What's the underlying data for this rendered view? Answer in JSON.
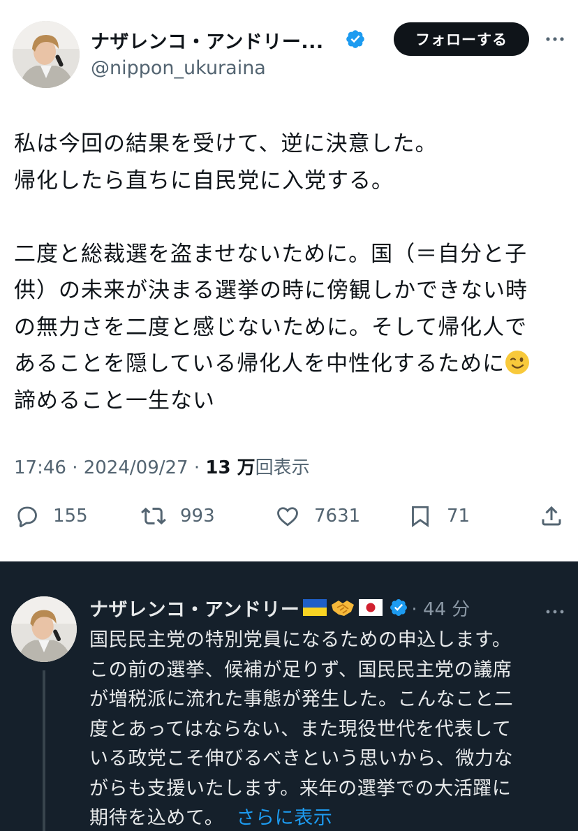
{
  "tweet": {
    "author_name": "ナザレンコ・アンドリー...",
    "handle": "@nippon_ukuraina",
    "follow_label": "フォローする",
    "body_lines": [
      "私は今回の結果を受けて、逆に決意した。",
      "帰化したら直ちに自民党に入党する。",
      "",
      "二度と総裁選を盗ませないために。国（＝自分と子",
      "供）の未来が決まる選挙の時に傍観しかできない時",
      "の無力さを二度と感じないために。そして帰化人で",
      "あることを隠している帰化人を中性化するために",
      "諦めること一生ない"
    ],
    "timestamp": "17:46 · 2024/09/27 · ",
    "views_count": "13 万",
    "views_label": "回表示",
    "stats": {
      "replies": "155",
      "retweets": "993",
      "likes": "7631",
      "bookmarks": "71"
    }
  },
  "reply": {
    "author_name": "ナザレンコ・アンドリー",
    "time": "· 44 分",
    "body_lines": [
      "国民民主党の特別党員になるための申込します。",
      "この前の選挙、候補が足りず、国民民主党の議席",
      "が増税派に流れた事態が発生した。こんなこと二",
      "度とあってはならない、また現役世代を代表して",
      "いる政党こそ伸びるべきという思いから、微力な",
      "がらも支援いたします。来年の選挙での大活躍に",
      "期待を込めて。"
    ],
    "show_more": "さらに表示"
  },
  "icons": {
    "verified": "verified-badge-icon",
    "more": "more-icon",
    "reply": "reply-icon",
    "retweet": "retweet-icon",
    "like": "heart-icon",
    "bookmark": "bookmark-icon",
    "share": "share-icon",
    "emoji_wink": "winking-face-emoji",
    "flag_ua": "ukraine-flag-emoji",
    "handshake": "handshake-emoji",
    "flag_jp": "japan-flag-emoji"
  },
  "colors": {
    "accent": "#1d9bf0",
    "text": "#0f1419",
    "muted": "#536471",
    "dark_bg": "#15202b",
    "dark_text": "#e7e9ea",
    "dark_muted": "#8b98a5"
  }
}
